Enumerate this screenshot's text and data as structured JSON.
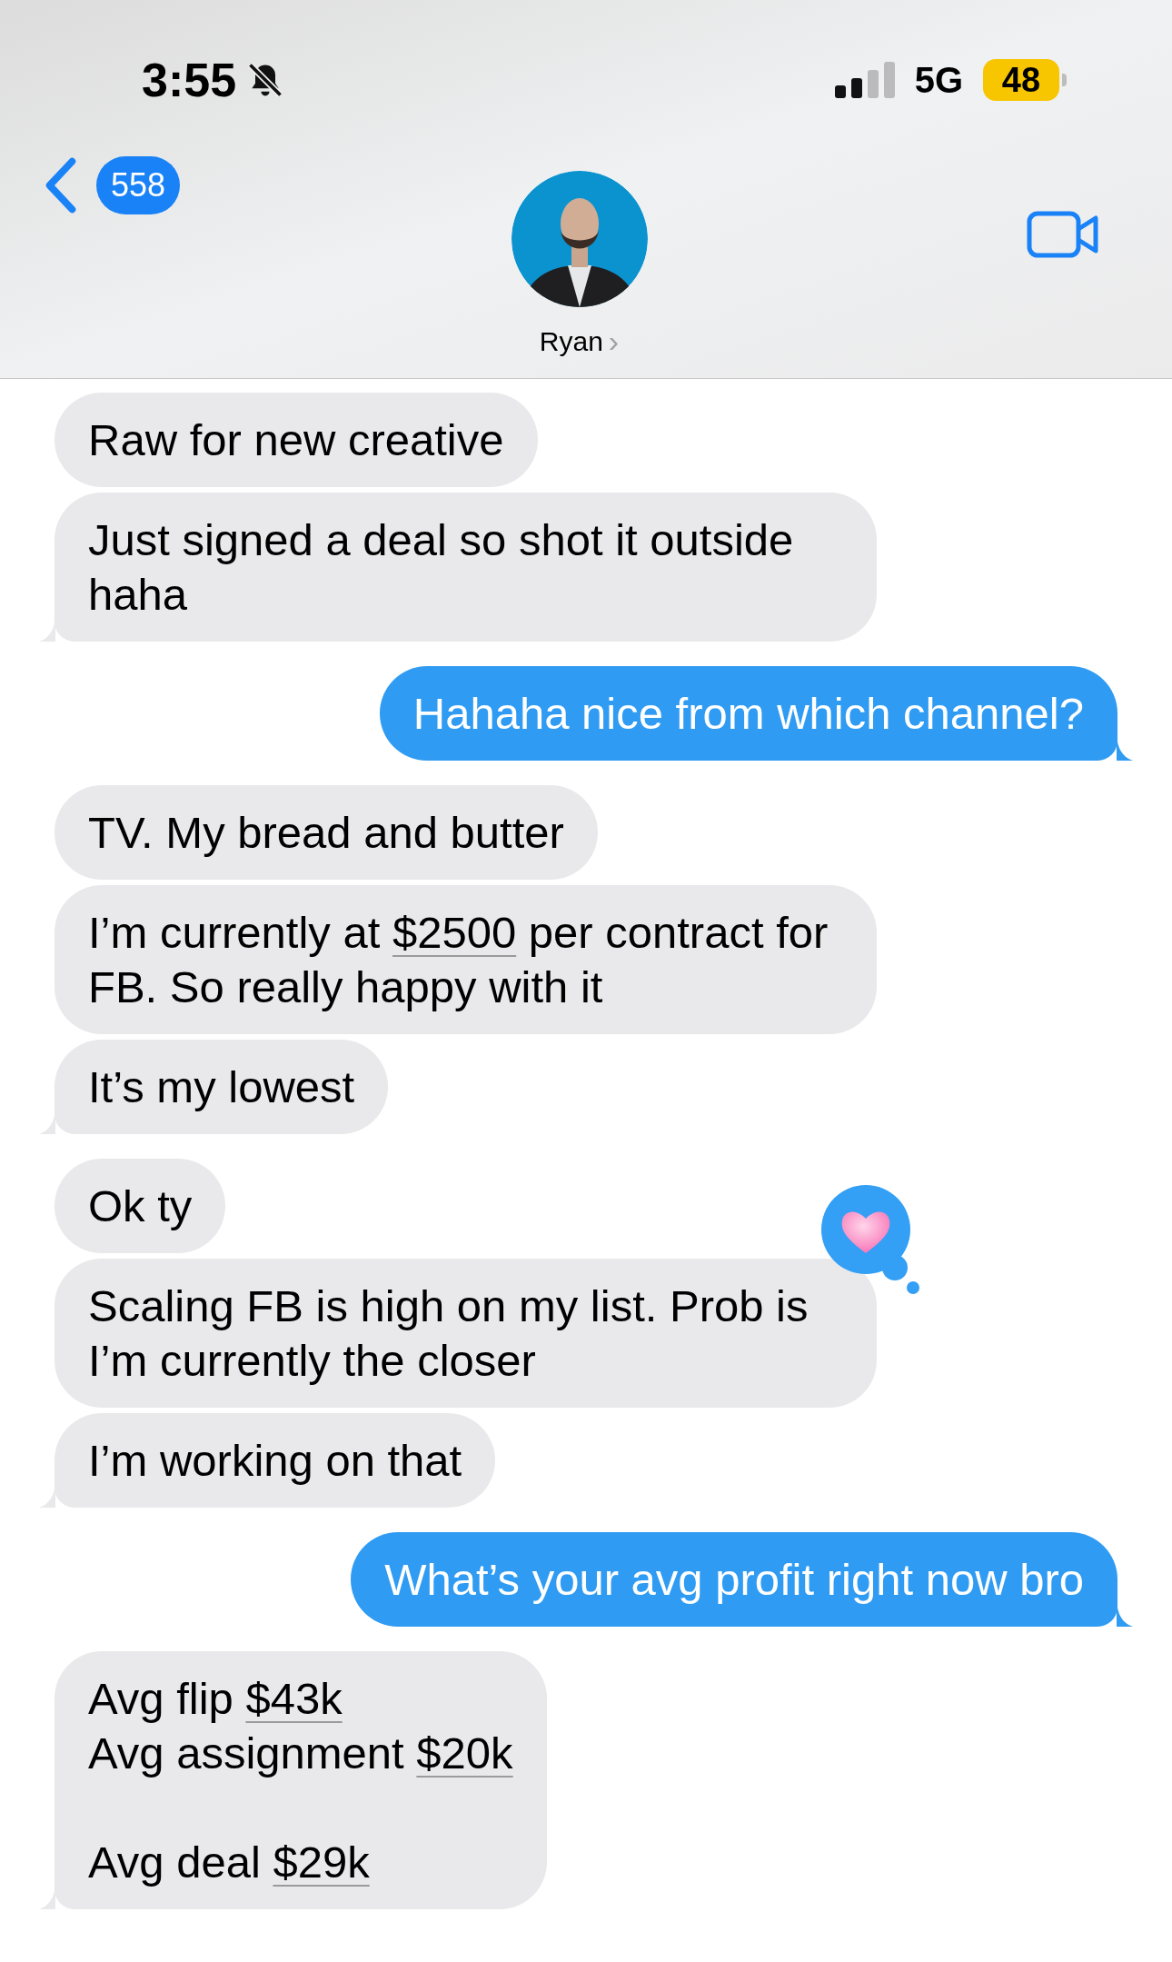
{
  "status_bar": {
    "time": "3:55",
    "network": "5G",
    "battery": "48"
  },
  "header": {
    "back_badge": "558",
    "contact": "Ryan",
    "chevron": "›"
  },
  "groups": [
    {
      "kind": "incoming",
      "messages": [
        {
          "parts": [
            {
              "kind": "text",
              "text": "Raw for new creative"
            }
          ]
        },
        {
          "parts": [
            {
              "kind": "text",
              "text": "Just signed a deal so shot it outside haha"
            }
          ]
        }
      ]
    },
    {
      "kind": "outgoing",
      "messages": [
        {
          "parts": [
            {
              "kind": "text",
              "text": "Hahaha nice from which channel?"
            }
          ]
        }
      ]
    },
    {
      "kind": "incoming",
      "messages": [
        {
          "parts": [
            {
              "kind": "text",
              "text": "TV. My bread and butter"
            }
          ]
        },
        {
          "parts": [
            {
              "kind": "text",
              "text": "I’m currently at "
            },
            {
              "kind": "link",
              "text": "$2500"
            },
            {
              "kind": "text",
              "text": " per contract for FB. So really happy with it"
            }
          ]
        },
        {
          "parts": [
            {
              "kind": "text",
              "text": "It’s my lowest"
            }
          ]
        }
      ]
    },
    {
      "kind": "incoming",
      "messages": [
        {
          "parts": [
            {
              "kind": "text",
              "text": "Ok ty"
            }
          ]
        },
        {
          "reaction": {
            "kind": "heart"
          },
          "parts": [
            {
              "kind": "text",
              "text": "Scaling FB is high on my list. Prob is I’m currently the closer"
            }
          ]
        },
        {
          "parts": [
            {
              "kind": "text",
              "text": "I’m working on that"
            }
          ]
        }
      ]
    },
    {
      "kind": "outgoing",
      "messages": [
        {
          "parts": [
            {
              "kind": "text",
              "text": "What’s your avg profit right now bro"
            }
          ]
        }
      ]
    },
    {
      "kind": "incoming",
      "messages": [
        {
          "parts": [
            {
              "kind": "text",
              "text": "Avg flip "
            },
            {
              "kind": "link",
              "text": "$43k"
            },
            {
              "kind": "text",
              "text": "\nAvg assignment "
            },
            {
              "kind": "link",
              "text": "$20k"
            },
            {
              "kind": "text",
              "text": "\n\nAvg deal "
            },
            {
              "kind": "link",
              "text": "$29k"
            }
          ]
        }
      ]
    }
  ]
}
